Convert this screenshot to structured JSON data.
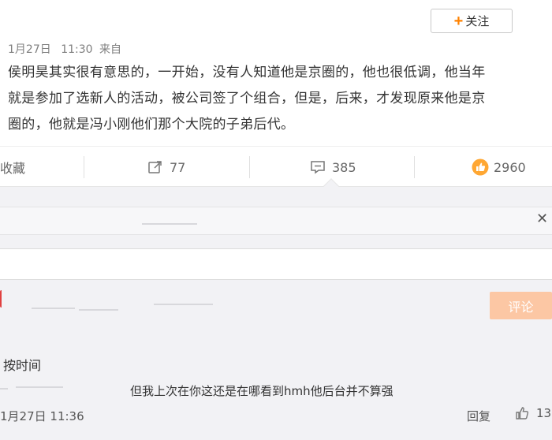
{
  "header": {
    "follow_label": "关注"
  },
  "post": {
    "date": "1月27日",
    "time": "11:30",
    "source_prefix": "来自",
    "lines": [
      "侯明昊其实很有意思的，一开始，没有人知道他是京圈的，他也很低调，他当年",
      "就是参加了选新人的活动，被公司签了个组合，但是，后来，才发现原来他是京",
      "圈的，他就是冯小刚他们那个大院的子弟后代。"
    ]
  },
  "actions": {
    "favorite_label": "收藏",
    "repost_count": "77",
    "comment_count": "385",
    "like_count": "2960"
  },
  "comments": {
    "submit_label": "评论",
    "sort_label": "按时间",
    "items": [
      {
        "text": "但我上次在你这还是在哪看到hmh他后台并不算强",
        "time": "1月27日 11:36",
        "reply_label": "回复",
        "like_count": "13"
      }
    ]
  },
  "icons": [
    "plus-icon",
    "repost-icon",
    "comment-icon",
    "like-icon",
    "close-icon",
    "like-outline-icon"
  ],
  "colors": {
    "accent": "#ff8200",
    "submit_bg": "#fcc7a4",
    "like_badge": "#ffa733"
  }
}
